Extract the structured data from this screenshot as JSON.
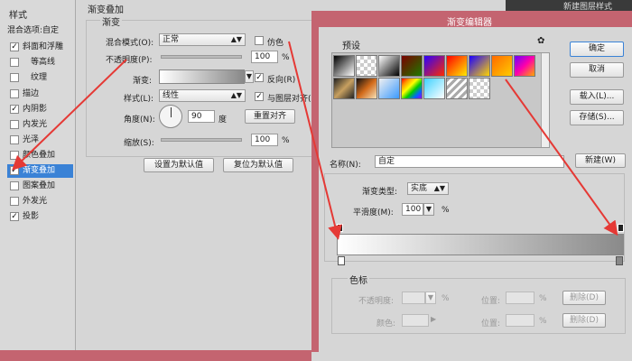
{
  "sidebar": {
    "title": "样式",
    "blend_options": "混合选项:自定",
    "items": [
      {
        "label": "斜面和浮雕",
        "checked": true
      },
      {
        "label": "等高线",
        "checked": false
      },
      {
        "label": "纹理",
        "checked": false
      },
      {
        "label": "描边",
        "checked": false
      },
      {
        "label": "内阴影",
        "checked": true
      },
      {
        "label": "内发光",
        "checked": false
      },
      {
        "label": "光泽",
        "checked": false
      },
      {
        "label": "颜色叠加",
        "checked": false
      },
      {
        "label": "渐变叠加",
        "checked": true
      },
      {
        "label": "图案叠加",
        "checked": false
      },
      {
        "label": "外发光",
        "checked": false
      },
      {
        "label": "投影",
        "checked": true
      }
    ]
  },
  "panel": {
    "section_title": "渐变叠加",
    "group_title": "渐变",
    "blend_mode_label": "混合模式(O):",
    "blend_mode_value": "正常",
    "dither_label": "仿色",
    "opacity_label": "不透明度(P):",
    "opacity_value": "100",
    "percent": "%",
    "gradient_label": "渐变:",
    "reverse_label": "反向(R)",
    "style_label": "样式(L):",
    "style_value": "线性",
    "align_label": "与图层对齐(I)",
    "angle_label": "角度(N):",
    "angle_value": "90",
    "degree": "度",
    "reset_align": "重置对齐",
    "scale_label": "缩放(S):",
    "scale_value": "100",
    "make_default": "设置为默认值",
    "reset_default": "复位为默认值"
  },
  "topright_label": "新建图层样式",
  "editor": {
    "title": "渐变编辑器",
    "presets_label": "预设",
    "ok": "确定",
    "cancel": "取消",
    "load": "载入(L)...",
    "save": "存储(S)...",
    "name_label": "名称(N):",
    "name_value": "自定",
    "new_button": "新建(W)",
    "type_label": "渐变类型:",
    "type_value": "实底",
    "smooth_label": "平滑度(M):",
    "smooth_value": "100",
    "percent": "%",
    "stops_title": "色标",
    "stop_opacity_label": "不透明度:",
    "location_label": "位置:",
    "delete_label": "删除(D)",
    "color_label": "颜色:"
  },
  "colors": {
    "accent": "#3a82d6",
    "dialog_border": "#c46470",
    "arrow": "#e53935"
  }
}
